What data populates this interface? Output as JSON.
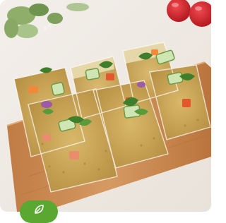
{
  "image": {
    "subject": "",
    "colors": {
      "background": "#efe9e2",
      "board": "#c98a4f",
      "badge": "#5aa832",
      "tomato": "#d8222b"
    }
  },
  "badge": {
    "icon": "leaf-icon"
  }
}
